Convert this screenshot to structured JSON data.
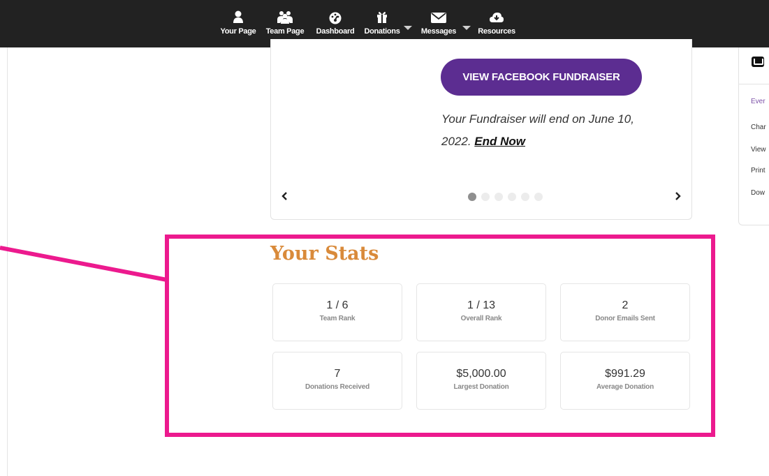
{
  "nav": {
    "items": [
      {
        "label": "Your Page",
        "icon": "person-icon"
      },
      {
        "label": "Team Page",
        "icon": "people-icon"
      },
      {
        "label": "Dashboard",
        "icon": "dashboard-icon"
      },
      {
        "label": "Donations",
        "icon": "gift-icon"
      },
      {
        "label": "Messages",
        "icon": "envelope-icon"
      },
      {
        "label": "Resources",
        "icon": "cloud-download-icon"
      }
    ]
  },
  "carousel": {
    "button_label": "VIEW FACEBOOK FUNDRAISER",
    "end_text": "Your Fundraiser will end on June 10, 2022.",
    "end_link": "End Now",
    "slide_count": 6,
    "active_slide": 1
  },
  "sidebar": {
    "links": [
      "Ever",
      "Char",
      "View",
      "Print",
      "Dow"
    ]
  },
  "stats": {
    "title": "Your Stats",
    "cards": [
      {
        "value": "1 / 6",
        "label": "Team Rank"
      },
      {
        "value": "1 / 13",
        "label": "Overall Rank"
      },
      {
        "value": "2",
        "label": "Donor Emails Sent"
      },
      {
        "value": "7",
        "label": "Donations Received"
      },
      {
        "value": "$5,000.00",
        "label": "Largest Donation"
      },
      {
        "value": "$991.29",
        "label": "Average Donation"
      }
    ]
  },
  "colors": {
    "nav_bg": "#222222",
    "button_purple": "#5c2d91",
    "highlight_pink": "#ec1a8e",
    "title_orange": "#d98a3a"
  }
}
